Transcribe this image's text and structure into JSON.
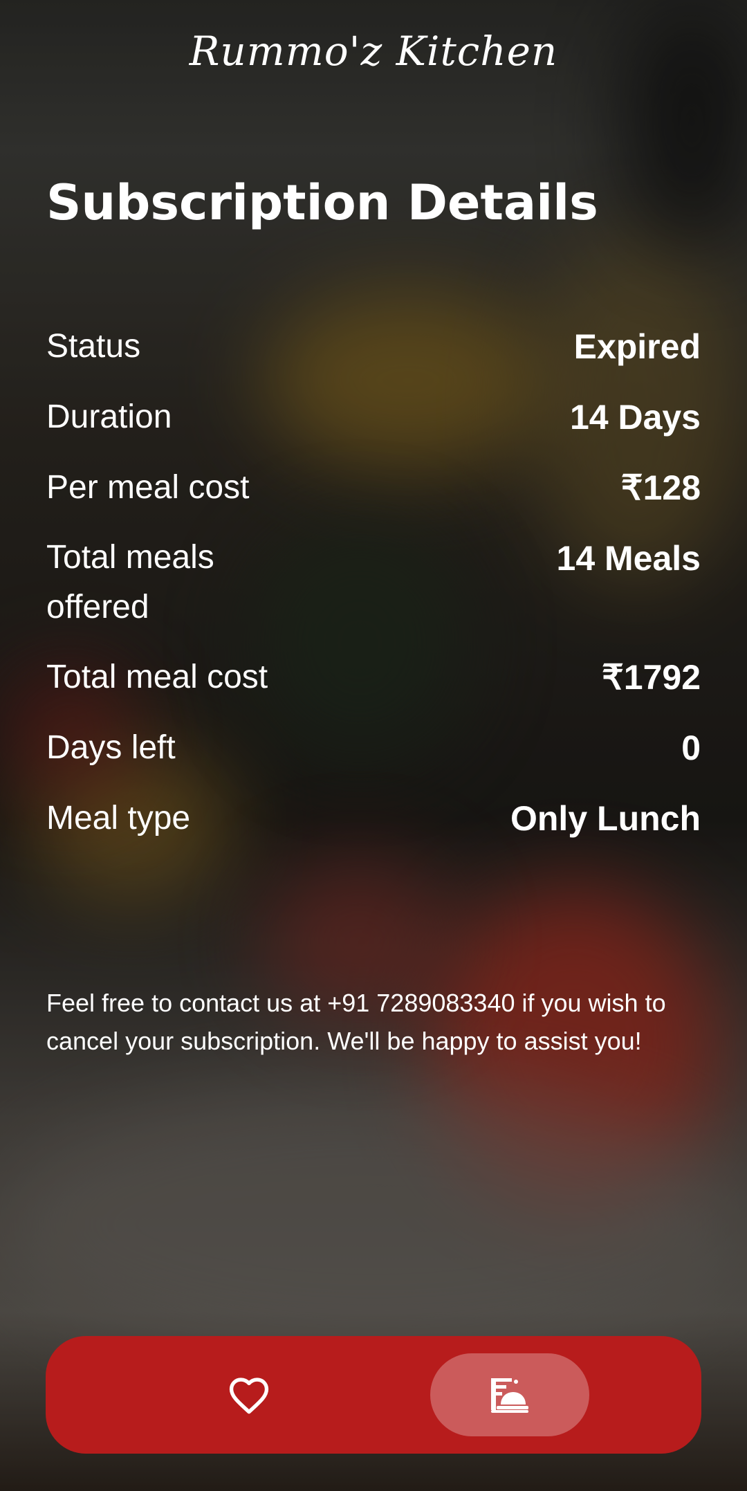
{
  "app": {
    "brand": "Rummo'z Kitchen"
  },
  "page": {
    "title": "Subscription Details"
  },
  "details": [
    {
      "label": "Status",
      "value": "Expired"
    },
    {
      "label": "Duration",
      "value": "14 Days"
    },
    {
      "label": "Per meal cost",
      "value": "₹128"
    },
    {
      "label": "Total meals offered",
      "value": "14 Meals"
    },
    {
      "label": "Total meal cost",
      "value": "₹1792"
    },
    {
      "label": "Days left",
      "value": "0"
    },
    {
      "label": "Meal type",
      "value": "Only Lunch"
    }
  ],
  "note": "Feel free to contact us at +91 7289083340 if you wish to cancel your subscription. We'll be happy to assist you!",
  "nav": {
    "accent": "#b71c1c",
    "items": [
      {
        "icon": "heart-icon",
        "selected": false
      },
      {
        "icon": "meal-service-icon",
        "selected": true
      }
    ]
  }
}
